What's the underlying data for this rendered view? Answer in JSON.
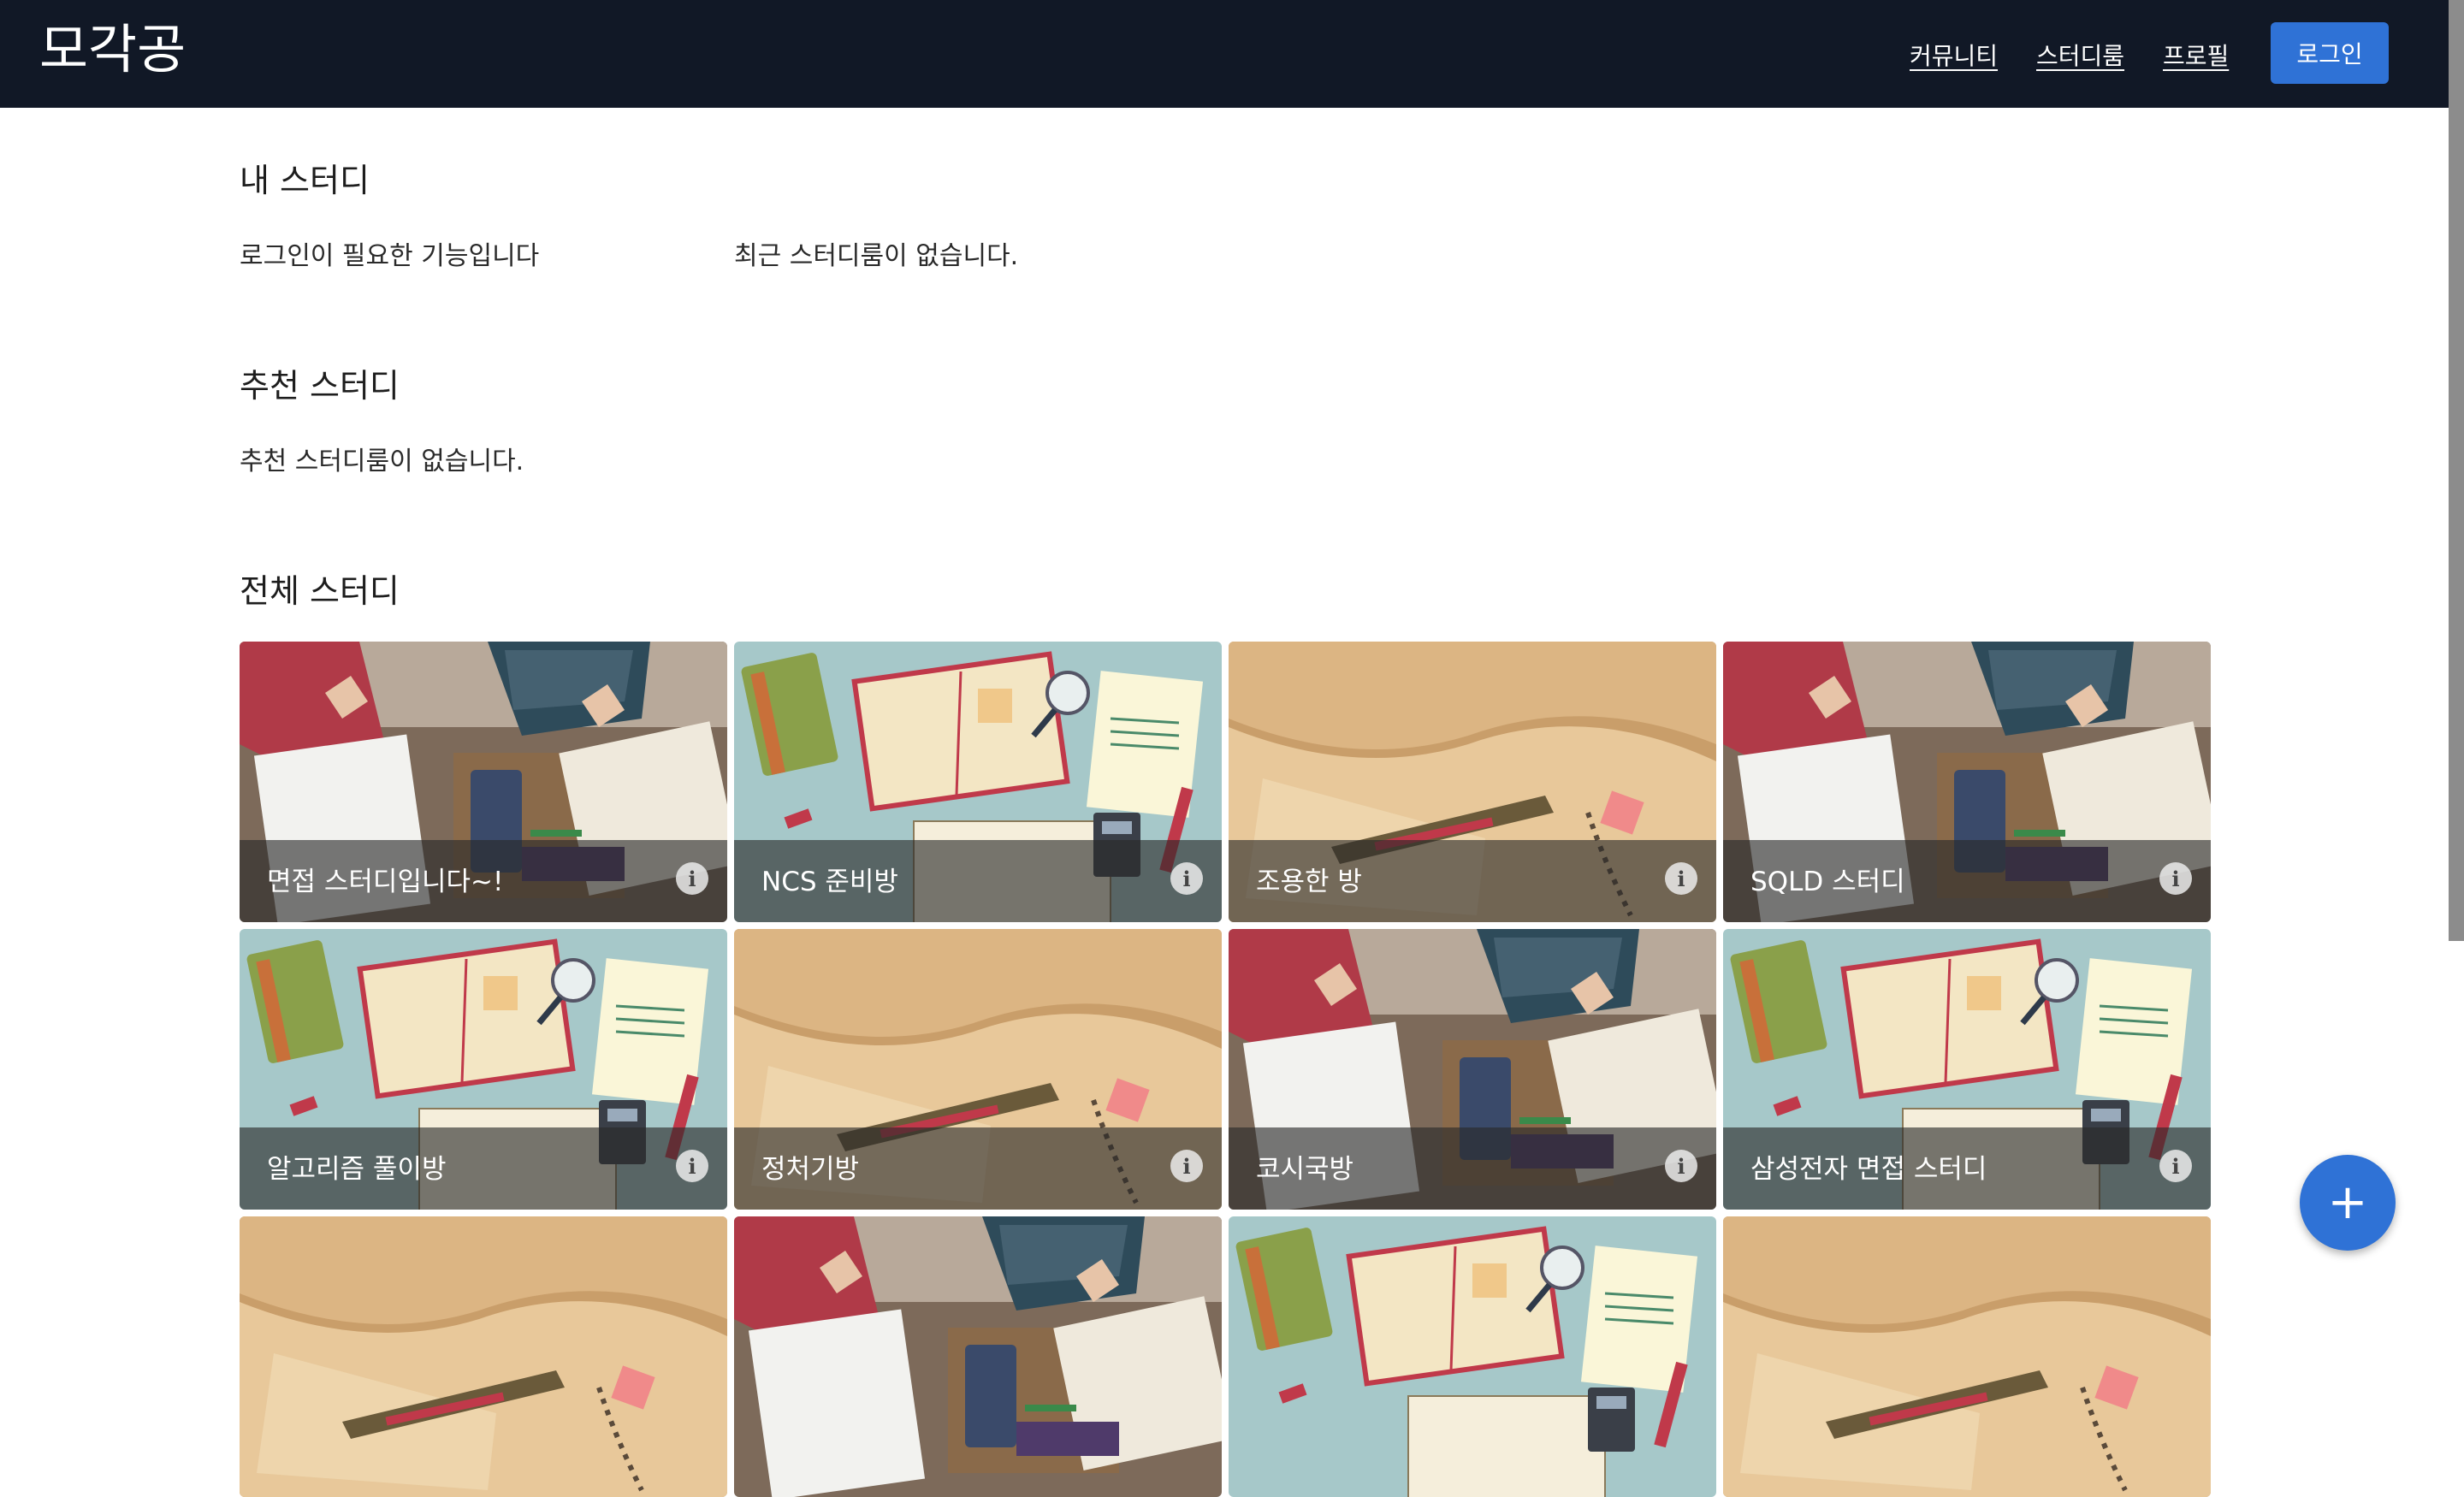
{
  "header": {
    "brand": "모각공",
    "nav": [
      {
        "label": "커뮤니티"
      },
      {
        "label": "스터디룸"
      },
      {
        "label": "프로필"
      }
    ],
    "login_label": "로그인"
  },
  "my_study": {
    "title": "내 스터디",
    "login_required": "로그인이 필요한 기능입니다",
    "no_recent": "최근 스터디룸이 없습니다."
  },
  "recommended": {
    "title": "추천 스터디",
    "empty": "추천 스터디룸이 없습니다."
  },
  "all_study": {
    "title": "전체 스터디",
    "cards": [
      {
        "title": "면접 스터디입니다~!",
        "image": "desk-writing"
      },
      {
        "title": "NCS 준비방",
        "image": "illustration-books"
      },
      {
        "title": "조용한 방",
        "image": "open-book"
      },
      {
        "title": "SQLD 스터디",
        "image": "desk-writing"
      },
      {
        "title": "알고리즘 풀이방",
        "image": "illustration-books"
      },
      {
        "title": "정처기방",
        "image": "open-book"
      },
      {
        "title": "코시국방",
        "image": "desk-writing"
      },
      {
        "title": "삼성전자 면접 스터디",
        "image": "illustration-books"
      },
      {
        "title": "",
        "image": "open-book"
      },
      {
        "title": "",
        "image": "desk-writing"
      },
      {
        "title": "",
        "image": "illustration-books"
      },
      {
        "title": "",
        "image": "open-book"
      }
    ]
  },
  "fab": {
    "icon": "plus-icon",
    "label": "+"
  },
  "colors": {
    "navbar": "#111826",
    "accent": "#2f72d6"
  }
}
